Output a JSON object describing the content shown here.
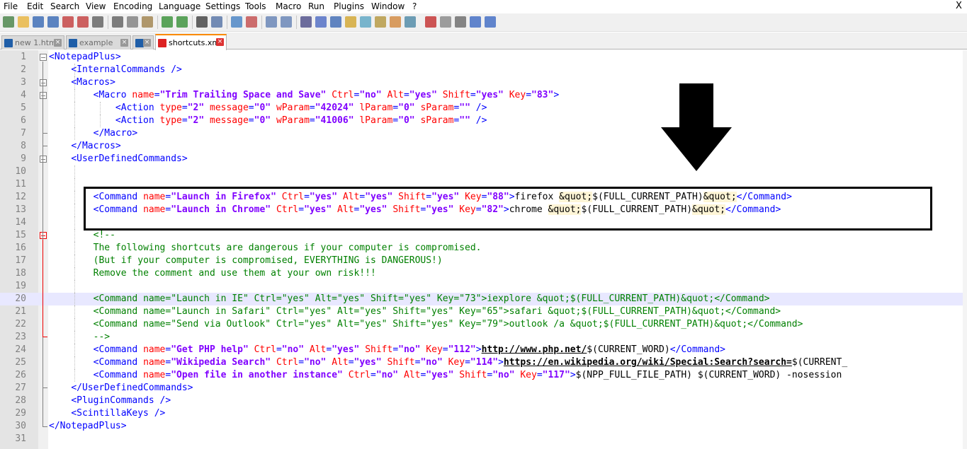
{
  "menu": [
    "File",
    "Edit",
    "Search",
    "View",
    "Encoding",
    "Language",
    "Settings",
    "Tools",
    "Macro",
    "Run",
    "Plugins",
    "Window",
    "?"
  ],
  "window_close": "X",
  "tabs": [
    {
      "label": "new 1.html",
      "active": false
    },
    {
      "label": "example",
      "active": false
    },
    {
      "label": "2",
      "active": false
    },
    {
      "label": "shortcuts.xml",
      "active": true
    }
  ],
  "toolbar_icons": [
    "new-file-icon",
    "open-file-icon",
    "save-icon",
    "save-all-icon",
    "close-icon",
    "close-all-icon",
    "print-icon",
    "cut-icon",
    "copy-icon",
    "paste-icon",
    "undo-icon",
    "redo-icon",
    "find-icon",
    "replace-icon",
    "zoom-in-icon",
    "zoom-out-icon",
    "sync-vertical-icon",
    "sync-horizontal-icon",
    "word-wrap-icon",
    "show-all-chars-icon",
    "indent-guide-icon",
    "udl-icon",
    "doc-map-icon",
    "function-list-icon",
    "folder-workspace-icon",
    "monitoring-icon",
    "record-macro-icon",
    "stop-record-icon",
    "play-macro-icon",
    "run-macro-multiple-icon",
    "save-macro-icon"
  ],
  "current_line": 20,
  "lines": [
    {
      "n": "1",
      "fold": "open",
      "seg": [
        [
          "t",
          "<NotepadPlus>"
        ]
      ]
    },
    {
      "n": "2",
      "seg": [
        [
          "x",
          "    "
        ],
        [
          "t",
          "<InternalCommands />"
        ]
      ]
    },
    {
      "n": "3",
      "fold": "open",
      "seg": [
        [
          "x",
          "    "
        ],
        [
          "t",
          "<Macros>"
        ]
      ]
    },
    {
      "n": "4",
      "fold": "open",
      "seg": [
        [
          "x",
          "        "
        ],
        [
          "t",
          "<Macro "
        ],
        [
          "a",
          "name"
        ],
        [
          "t",
          "="
        ],
        [
          "s",
          "\"Trim Trailing Space and Save\""
        ],
        [
          "t",
          " "
        ],
        [
          "a",
          "Ctrl"
        ],
        [
          "t",
          "="
        ],
        [
          "s",
          "\"no\""
        ],
        [
          "t",
          " "
        ],
        [
          "a",
          "Alt"
        ],
        [
          "t",
          "="
        ],
        [
          "s",
          "\"yes\""
        ],
        [
          "t",
          " "
        ],
        [
          "a",
          "Shift"
        ],
        [
          "t",
          "="
        ],
        [
          "s",
          "\"yes\""
        ],
        [
          "t",
          " "
        ],
        [
          "a",
          "Key"
        ],
        [
          "t",
          "="
        ],
        [
          "s",
          "\"83\""
        ],
        [
          "t",
          ">"
        ]
      ]
    },
    {
      "n": "5",
      "seg": [
        [
          "x",
          "            "
        ],
        [
          "t",
          "<Action "
        ],
        [
          "a",
          "type"
        ],
        [
          "t",
          "="
        ],
        [
          "s",
          "\"2\""
        ],
        [
          "t",
          " "
        ],
        [
          "a",
          "message"
        ],
        [
          "t",
          "="
        ],
        [
          "s",
          "\"0\""
        ],
        [
          "t",
          " "
        ],
        [
          "a",
          "wParam"
        ],
        [
          "t",
          "="
        ],
        [
          "s",
          "\"42024\""
        ],
        [
          "t",
          " "
        ],
        [
          "a",
          "lParam"
        ],
        [
          "t",
          "="
        ],
        [
          "s",
          "\"0\""
        ],
        [
          "t",
          " "
        ],
        [
          "a",
          "sParam"
        ],
        [
          "t",
          "="
        ],
        [
          "s",
          "\"\""
        ],
        [
          "t",
          " />"
        ]
      ]
    },
    {
      "n": "6",
      "seg": [
        [
          "x",
          "            "
        ],
        [
          "t",
          "<Action "
        ],
        [
          "a",
          "type"
        ],
        [
          "t",
          "="
        ],
        [
          "s",
          "\"2\""
        ],
        [
          "t",
          " "
        ],
        [
          "a",
          "message"
        ],
        [
          "t",
          "="
        ],
        [
          "s",
          "\"0\""
        ],
        [
          "t",
          " "
        ],
        [
          "a",
          "wParam"
        ],
        [
          "t",
          "="
        ],
        [
          "s",
          "\"41006\""
        ],
        [
          "t",
          " "
        ],
        [
          "a",
          "lParam"
        ],
        [
          "t",
          "="
        ],
        [
          "s",
          "\"0\""
        ],
        [
          "t",
          " "
        ],
        [
          "a",
          "sParam"
        ],
        [
          "t",
          "="
        ],
        [
          "s",
          "\"\""
        ],
        [
          "t",
          " />"
        ]
      ]
    },
    {
      "n": "7",
      "seg": [
        [
          "x",
          "        "
        ],
        [
          "t",
          "</Macro>"
        ]
      ]
    },
    {
      "n": "8",
      "seg": [
        [
          "x",
          "    "
        ],
        [
          "t",
          "</Macros>"
        ]
      ]
    },
    {
      "n": "9",
      "fold": "open",
      "seg": [
        [
          "x",
          "    "
        ],
        [
          "t",
          "<UserDefinedCommands>"
        ]
      ]
    },
    {
      "n": "10",
      "seg": []
    },
    {
      "n": "11",
      "seg": []
    },
    {
      "n": "12",
      "seg": [
        [
          "x",
          "        "
        ],
        [
          "t",
          "<Command "
        ],
        [
          "a",
          "name"
        ],
        [
          "t",
          "="
        ],
        [
          "s",
          "\"Launch in Firefox\""
        ],
        [
          "t",
          " "
        ],
        [
          "a",
          "Ctrl"
        ],
        [
          "t",
          "="
        ],
        [
          "s",
          "\"yes\""
        ],
        [
          "t",
          " "
        ],
        [
          "a",
          "Alt"
        ],
        [
          "t",
          "="
        ],
        [
          "s",
          "\"yes\""
        ],
        [
          "t",
          " "
        ],
        [
          "a",
          "Shift"
        ],
        [
          "t",
          "="
        ],
        [
          "s",
          "\"yes\""
        ],
        [
          "t",
          " "
        ],
        [
          "a",
          "Key"
        ],
        [
          "t",
          "="
        ],
        [
          "s",
          "\"88\""
        ],
        [
          "t",
          ">"
        ],
        [
          "x",
          "firefox "
        ],
        [
          "e",
          "&quot;"
        ],
        [
          "x",
          "$(FULL_CURRENT_PATH)"
        ],
        [
          "e",
          "&quot;"
        ],
        [
          "t",
          "</Command>"
        ]
      ]
    },
    {
      "n": "13",
      "seg": [
        [
          "x",
          "        "
        ],
        [
          "t",
          "<Command "
        ],
        [
          "a",
          "name"
        ],
        [
          "t",
          "="
        ],
        [
          "s",
          "\"Launch in Chrome\""
        ],
        [
          "t",
          " "
        ],
        [
          "a",
          "Ctrl"
        ],
        [
          "t",
          "="
        ],
        [
          "s",
          "\"yes\""
        ],
        [
          "t",
          " "
        ],
        [
          "a",
          "Alt"
        ],
        [
          "t",
          "="
        ],
        [
          "s",
          "\"yes\""
        ],
        [
          "t",
          " "
        ],
        [
          "a",
          "Shift"
        ],
        [
          "t",
          "="
        ],
        [
          "s",
          "\"yes\""
        ],
        [
          "t",
          " "
        ],
        [
          "a",
          "Key"
        ],
        [
          "t",
          "="
        ],
        [
          "s",
          "\"82\""
        ],
        [
          "t",
          ">"
        ],
        [
          "x",
          "chrome "
        ],
        [
          "e",
          "&quot;"
        ],
        [
          "x",
          "$(FULL_CURRENT_PATH)"
        ],
        [
          "e",
          "&quot;"
        ],
        [
          "t",
          "</Command>"
        ]
      ]
    },
    {
      "n": "14",
      "seg": []
    },
    {
      "n": "15",
      "fold": "red",
      "seg": [
        [
          "x",
          "        "
        ],
        [
          "c",
          "<!--"
        ]
      ]
    },
    {
      "n": "16",
      "seg": [
        [
          "x",
          "        "
        ],
        [
          "c",
          "The following shortcuts are dangerous if your computer is compromised."
        ]
      ]
    },
    {
      "n": "17",
      "seg": [
        [
          "x",
          "        "
        ],
        [
          "c",
          "(But if your computer is compromised, EVERYTHING is DANGEROUS!)"
        ]
      ]
    },
    {
      "n": "18",
      "seg": [
        [
          "x",
          "        "
        ],
        [
          "c",
          "Remove the comment and use them at your own risk!!!"
        ]
      ]
    },
    {
      "n": "19",
      "seg": []
    },
    {
      "n": "20",
      "seg": [
        [
          "x",
          "        "
        ],
        [
          "c",
          "<Command name=\"Launch in IE\" Ctrl=\"yes\" Alt=\"yes\" Shift=\"yes\" Key=\"73\">iexplore &quot;$(FULL_CURRENT_PATH)&quot;</Command>"
        ]
      ]
    },
    {
      "n": "21",
      "seg": [
        [
          "x",
          "        "
        ],
        [
          "c",
          "<Command name=\"Launch in Safari\" Ctrl=\"yes\" Alt=\"yes\" Shift=\"yes\" Key=\"65\">safari &quot;$(FULL_CURRENT_PATH)&quot;</Command>"
        ]
      ]
    },
    {
      "n": "22",
      "seg": [
        [
          "x",
          "        "
        ],
        [
          "c",
          "<Command name=\"Send via Outlook\" Ctrl=\"yes\" Alt=\"yes\" Shift=\"yes\" Key=\"79\">outlook /a &quot;$(FULL_CURRENT_PATH)&quot;</Command>"
        ]
      ]
    },
    {
      "n": "23",
      "seg": [
        [
          "x",
          "        "
        ],
        [
          "c",
          "-->"
        ]
      ]
    },
    {
      "n": "24",
      "seg": [
        [
          "x",
          "        "
        ],
        [
          "t",
          "<Command "
        ],
        [
          "a",
          "name"
        ],
        [
          "t",
          "="
        ],
        [
          "s",
          "\"Get PHP help\""
        ],
        [
          "t",
          " "
        ],
        [
          "a",
          "Ctrl"
        ],
        [
          "t",
          "="
        ],
        [
          "s",
          "\"no\""
        ],
        [
          "t",
          " "
        ],
        [
          "a",
          "Alt"
        ],
        [
          "t",
          "="
        ],
        [
          "s",
          "\"yes\""
        ],
        [
          "t",
          " "
        ],
        [
          "a",
          "Shift"
        ],
        [
          "t",
          "="
        ],
        [
          "s",
          "\"no\""
        ],
        [
          "t",
          " "
        ],
        [
          "a",
          "Key"
        ],
        [
          "t",
          "="
        ],
        [
          "s",
          "\"112\""
        ],
        [
          "t",
          ">"
        ],
        [
          "u",
          "http://www.php.net/"
        ],
        [
          "x",
          "$(CURRENT_WORD)"
        ],
        [
          "t",
          "</Command>"
        ]
      ]
    },
    {
      "n": "25",
      "seg": [
        [
          "x",
          "        "
        ],
        [
          "t",
          "<Command "
        ],
        [
          "a",
          "name"
        ],
        [
          "t",
          "="
        ],
        [
          "s",
          "\"Wikipedia Search\""
        ],
        [
          "t",
          " "
        ],
        [
          "a",
          "Ctrl"
        ],
        [
          "t",
          "="
        ],
        [
          "s",
          "\"no\""
        ],
        [
          "t",
          " "
        ],
        [
          "a",
          "Alt"
        ],
        [
          "t",
          "="
        ],
        [
          "s",
          "\"yes\""
        ],
        [
          "t",
          " "
        ],
        [
          "a",
          "Shift"
        ],
        [
          "t",
          "="
        ],
        [
          "s",
          "\"no\""
        ],
        [
          "t",
          " "
        ],
        [
          "a",
          "Key"
        ],
        [
          "t",
          "="
        ],
        [
          "s",
          "\"114\""
        ],
        [
          "t",
          ">"
        ],
        [
          "u",
          "https://en.wikipedia.org/wiki/Special:Search?search="
        ],
        [
          "x",
          "$(CURRENT_"
        ]
      ]
    },
    {
      "n": "26",
      "seg": [
        [
          "x",
          "        "
        ],
        [
          "t",
          "<Command "
        ],
        [
          "a",
          "name"
        ],
        [
          "t",
          "="
        ],
        [
          "s",
          "\"Open file in another instance\""
        ],
        [
          "t",
          " "
        ],
        [
          "a",
          "Ctrl"
        ],
        [
          "t",
          "="
        ],
        [
          "s",
          "\"no\""
        ],
        [
          "t",
          " "
        ],
        [
          "a",
          "Alt"
        ],
        [
          "t",
          "="
        ],
        [
          "s",
          "\"yes\""
        ],
        [
          "t",
          " "
        ],
        [
          "a",
          "Shift"
        ],
        [
          "t",
          "="
        ],
        [
          "s",
          "\"no\""
        ],
        [
          "t",
          " "
        ],
        [
          "a",
          "Key"
        ],
        [
          "t",
          "="
        ],
        [
          "s",
          "\"117\""
        ],
        [
          "t",
          ">"
        ],
        [
          "x",
          "$(NPP_FULL_FILE_PATH) $(CURRENT_WORD) -nosession"
        ]
      ]
    },
    {
      "n": "27",
      "seg": [
        [
          "x",
          "    "
        ],
        [
          "t",
          "</UserDefinedCommands>"
        ]
      ]
    },
    {
      "n": "28",
      "seg": [
        [
          "x",
          "    "
        ],
        [
          "t",
          "<PluginCommands />"
        ]
      ]
    },
    {
      "n": "29",
      "seg": [
        [
          "x",
          "    "
        ],
        [
          "t",
          "<ScintillaKeys />"
        ]
      ]
    },
    {
      "n": "30",
      "seg": [
        [
          "t",
          "</NotepadPlus>"
        ]
      ]
    },
    {
      "n": "31",
      "seg": []
    }
  ]
}
